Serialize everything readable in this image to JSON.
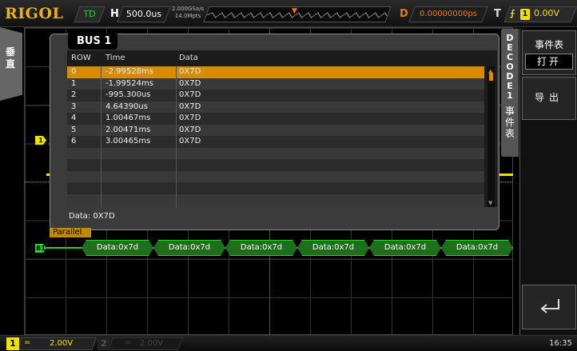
{
  "brand": "RIGOL",
  "header": {
    "trigger_status": "TD",
    "horizontal_label": "H",
    "timebase": "500.0us",
    "sample_rate": "2.000GSa/s",
    "memory_depth": "14.0Mpts",
    "delay_label": "D",
    "delay_value": "0.00000000ps",
    "trigger_label": "T",
    "trigger_source": "1",
    "trigger_level": "0.00V",
    "edge_icon": "rising-edge-icon"
  },
  "left_menu": {
    "label": "垂直"
  },
  "ch1_marker": "1",
  "bus_window": {
    "title": "BUS 1",
    "columns": [
      "ROW",
      "Time",
      "Data"
    ],
    "rows": [
      {
        "row": "0",
        "time": "-2.99528ms",
        "data": "0X7D",
        "selected": true
      },
      {
        "row": "1",
        "time": "-1.99524ms",
        "data": "0X7D"
      },
      {
        "row": "2",
        "time": "-995.300us",
        "data": "0X7D"
      },
      {
        "row": "3",
        "time": "4.64390us",
        "data": "0X7D"
      },
      {
        "row": "4",
        "time": "1.00467ms",
        "data": "0X7D"
      },
      {
        "row": "5",
        "time": "2.00471ms",
        "data": "0X7D"
      },
      {
        "row": "6",
        "time": "3.00465ms",
        "data": "0X7D"
      }
    ],
    "footer": "Data: 0X7D"
  },
  "decode": {
    "label": "Parallel",
    "marker": "B1",
    "segments": [
      "Data:0x7d",
      "Data:0x7d",
      "Data:0x7d",
      "Data:0x7d",
      "Data:0x7d",
      "Data:0x7d"
    ]
  },
  "right_menu": {
    "tab_label": "DECODE1",
    "event_tab_label": "事件表",
    "event_table_title": "事件表",
    "event_table_value": "打开",
    "export_label": "导出",
    "back_icon": "back-arrow-icon"
  },
  "bottom": {
    "ch1": "1",
    "ch1_coupling": "=",
    "ch1_scale": "2.00V",
    "ch2": "2",
    "ch2_coupling": "=",
    "ch2_scale": "2.00V",
    "time": "16:35"
  },
  "colors": {
    "ch1": "#f0e000",
    "bus": "#2bd12b",
    "accent": "#d88a00",
    "delay": "#f07800"
  }
}
